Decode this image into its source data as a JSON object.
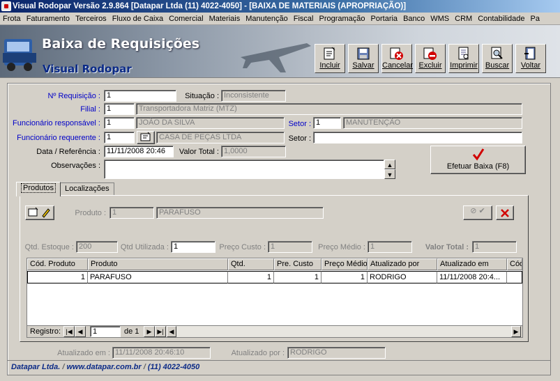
{
  "window": {
    "title": "Visual Rodopar Versão 2.9.864 [Datapar Ltda (11) 4022-4050]  - [BAIXA DE MATERIAIS (APROPRIAÇÃO)]"
  },
  "menu": [
    "Frota",
    "Faturamento",
    "Terceiros",
    "Fluxo de Caixa",
    "Comercial",
    "Materiais",
    "Manutenção",
    "Fiscal",
    "Programação",
    "Portaria",
    "Banco",
    "WMS",
    "CRM",
    "Contabilidade",
    "Pa"
  ],
  "banner": {
    "title": "Baixa de Requisições",
    "subtitle": "Visual Rodopar"
  },
  "toolbar": {
    "incluir": "Incluir",
    "salvar": "Salvar",
    "cancelar": "Cancelar",
    "excluir": "Excluir",
    "imprimir": "Imprimir",
    "buscar": "Buscar",
    "voltar": "Voltar"
  },
  "form": {
    "requisicao_label": "Nº Requisição :",
    "requisicao": "1",
    "situacao_label": "Situação :",
    "situacao": "Inconsistente",
    "filial_label": "Filial :",
    "filial_code": "1",
    "filial_name": "Transportadora Matriz (MTZ)",
    "func_resp_label": "Funcionário responsável :",
    "func_resp_code": "1",
    "func_resp_name": "JOÃO DA SILVA",
    "setor1_label": "Setor :",
    "setor1_code": "1",
    "setor1_name": "MANUTENÇÃO",
    "func_req_label": "Funcionário requerente :",
    "func_req_code": "1",
    "func_req_name": "CASA DE PEÇAS LTDA",
    "setor2_label": "Setor :",
    "setor2_value": "",
    "data_label": "Data / Referência :",
    "data": "11/11/2008 20:46",
    "valor_total_label": "Valor Total :",
    "valor_total": "1,0000",
    "obs_label": "Observações :",
    "obs": "",
    "efetuar_label": "Efetuar Baixa (F8)"
  },
  "tabs": [
    {
      "label": "Produtos"
    },
    {
      "label": "Localizações"
    }
  ],
  "produtos": {
    "produto_label": "Produto :",
    "produto_code": "1",
    "produto_name": "PARAFUSO",
    "qtd_estoque_label": "Qtd. Estoque :",
    "qtd_estoque": "200",
    "qtd_utilizada_label": "Qtd Utilizada :",
    "qtd_utilizada": "1",
    "preco_custo_label": "Preço Custo :",
    "preco_custo": "1",
    "preco_medio_label": "Preço Médio :",
    "preco_medio": "1",
    "valor_total_label": "Valor Total :",
    "valor_total": "1"
  },
  "grid": {
    "headers": [
      "Cód. Produto",
      "Produto",
      "Qtd.",
      "Pre. Custo",
      "Preço Médio",
      "Atualizado por",
      "Atualizado em",
      "Cód"
    ],
    "rows": [
      [
        "1",
        "PARAFUSO",
        "1",
        "1",
        "1",
        "RODRIGO",
        "11/11/2008 20:4...",
        ""
      ]
    ]
  },
  "navigator": {
    "registro_label": "Registro:",
    "current": "1",
    "of_label": "de 1"
  },
  "audit": {
    "atualizado_em_label": "Atualizado em :",
    "atualizado_em": "11/11/2008 20:46:10",
    "atualizado_por_label": "Atualizado por :",
    "atualizado_por": "RODRIGO"
  },
  "footer": {
    "company": "Datapar Ltda.",
    "site": "www.datapar.com.br",
    "phone": "(11) 4022-4050"
  }
}
